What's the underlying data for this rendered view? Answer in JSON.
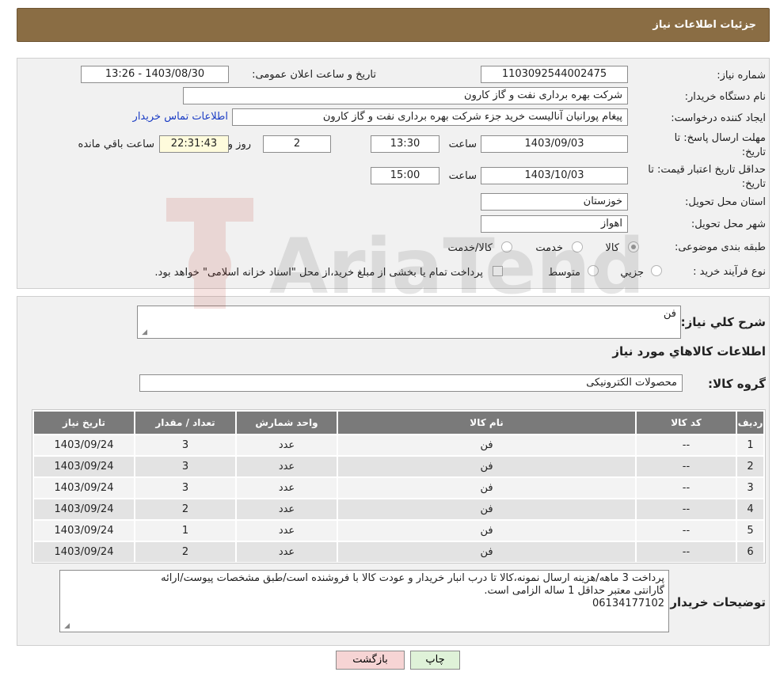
{
  "header": {
    "title": "جزئیات اطلاعات نیاز"
  },
  "need_number": {
    "label": "شماره نیاز:",
    "value": "1103092544002475"
  },
  "announce": {
    "label": "تاریخ و ساعت اعلان عمومی:",
    "value": "1403/08/30 - 13:26"
  },
  "buyer_org": {
    "label": "نام دستگاه خریدار:",
    "value": "شرکت بهره برداری نفت و گاز کارون"
  },
  "creator": {
    "label": "ایجاد کننده درخواست:",
    "value": "پیغام پورانیان آنالیست خرید جزء شرکت بهره برداری نفت و گاز کارون",
    "contact_link": "اطلاعات تماس خریدار"
  },
  "deadline": {
    "label": "مهلت ارسال پاسخ: تا تاریخ:",
    "date": "1403/09/03",
    "time_label": "ساعت",
    "time": "13:30",
    "days": "2",
    "days_label": "روز و",
    "remaining": "22:31:43",
    "remaining_label": "ساعت باقي مانده"
  },
  "price_validity": {
    "label": "حداقل تاريخ اعتبار قيمت: تا تاریخ:",
    "date": "1403/10/03",
    "time_label": "ساعت",
    "time": "15:00"
  },
  "province": {
    "label": "استان محل تحویل:",
    "value": "خوزستان"
  },
  "city": {
    "label": "شهر محل تحویل:",
    "value": "اهواز"
  },
  "category": {
    "label": "طبقه بندی موضوعی:",
    "options": [
      "کالا",
      "خدمت",
      "کالا/خدمت"
    ],
    "selected": "کالا"
  },
  "purchase_type": {
    "label": "نوع فرآیند خرید :",
    "options": [
      "جزیي",
      "متوسط"
    ],
    "note": "پرداخت تمام یا بخشی از مبلغ خرید،از محل \"اسناد خزانه اسلامی\" خواهد بود."
  },
  "general_desc": {
    "label": "شرح کلي نياز:",
    "value": "فن"
  },
  "goods_info_title": "اطلاعات کالاهاي مورد نياز",
  "goods_group": {
    "label": "گروه کالا:",
    "value": "محصولات الکترونیکی"
  },
  "table": {
    "columns": [
      "رديف",
      "کد کالا",
      "نام کالا",
      "واحد شمارش",
      "تعداد / مقدار",
      "تاريخ نياز"
    ],
    "rows": [
      [
        "1",
        "--",
        "فن",
        "عدد",
        "3",
        "1403/09/24"
      ],
      [
        "2",
        "--",
        "فن",
        "عدد",
        "3",
        "1403/09/24"
      ],
      [
        "3",
        "--",
        "فن",
        "عدد",
        "3",
        "1403/09/24"
      ],
      [
        "4",
        "--",
        "فن",
        "عدد",
        "2",
        "1403/09/24"
      ],
      [
        "5",
        "--",
        "فن",
        "عدد",
        "1",
        "1403/09/24"
      ],
      [
        "6",
        "--",
        "فن",
        "عدد",
        "2",
        "1403/09/24"
      ]
    ]
  },
  "buyer_notes": {
    "label": "توضیحات خریدار:",
    "lines": [
      "پرداخت 3 ماهه/هزینه ارسال نمونه،کالا تا درب انبار خریدار و عودت کالا با فروشنده است/طبق مشخصات پیوست/ارائه",
      "گارانتی معتبر حداقل 1 ساله الزامی است.",
      "06134177102"
    ]
  },
  "buttons": {
    "print": "چاپ",
    "back": "بازگشت"
  },
  "watermark": {
    "text": "AriaTender.neT"
  }
}
